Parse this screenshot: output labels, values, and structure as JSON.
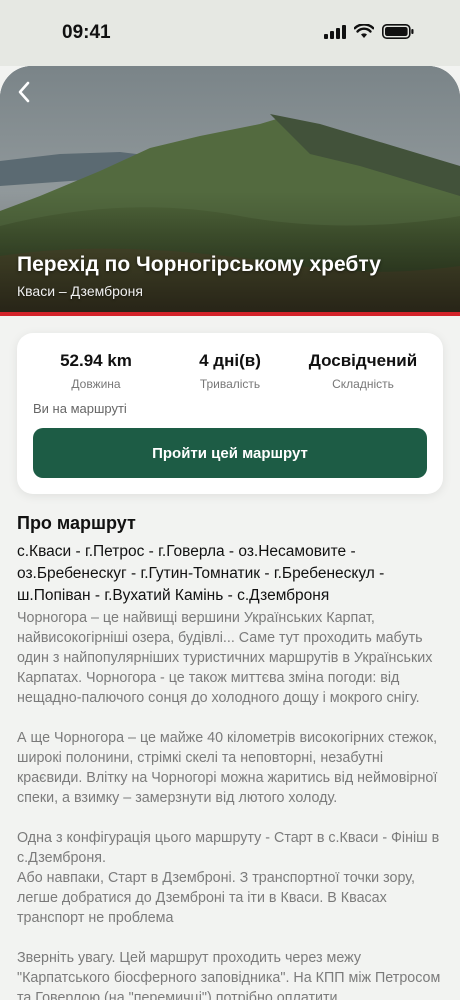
{
  "status": {
    "time": "09:41"
  },
  "hero": {
    "title": "Перехід по Чорногірському хребту",
    "subtitle": "Кваси – Дземброня",
    "accent_color": "#d3232a"
  },
  "stats": [
    {
      "value": "52.94 km",
      "label": "Довжина"
    },
    {
      "value": "4 дні(в)",
      "label": "Тривалість"
    },
    {
      "value": "Досвідчений",
      "label": "Складність"
    }
  ],
  "card": {
    "on_route_label": "Ви на маршруті",
    "cta_label": "Пройти цей маршрут",
    "cta_color": "#1d5c45"
  },
  "about": {
    "title": "Про маршрут",
    "route_points": "с.Кваси - г.Петрос - г.Говерла - оз.Несамовите - оз.Бребенескуг - г.Гутин-Томнатик - г.Бребенескул - ш.Попіван - г.Вухатий Камінь - с.Дземброня",
    "paragraphs": [
      "Чорногора – це найвищі вершини Українських Карпат, найвисокогірніші озера, будівлі... Саме тут проходить мабуть один з найпопулярніших туристичних маршрутів в Українських Карпатах. Чорногора - це також миттєва зміна погоди: від нещадно-палючого сонця до холодного дощу і мокрого снігу.",
      "А ще Чорногора – це майже 40 кілометрів високогірних стежок, широкі полонини, стрімкі скелі та неповторні, незабутні краєвиди. Влітку на Чорногорі можна жаритись від неймовірної спеки, а взимку – замерзнути від лютого холоду.",
      "Одна з конфігурація цього маршруту - Старт в с.Кваси - Фініш в с.Дземброня.\nАбо навпаки, Старт в Дземброні. З транспортної точки зору, легше добратися до Дземброні та іти в Кваси. В Квасах транспорт не проблема",
      "Зверніть увагу. Цей маршрут проходить через межу \"Карпатського біосферного заповідника\". На КПП між Петросом та Говерлою (на \"перемичці\") потрібно оплатити"
    ]
  }
}
